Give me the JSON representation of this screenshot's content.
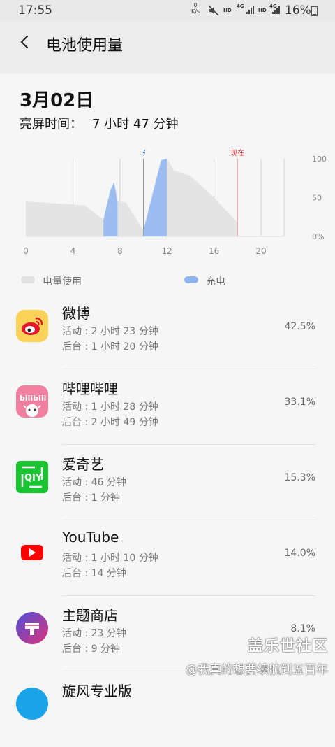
{
  "status": {
    "time": "17:55",
    "net_speed_value": "0",
    "net_speed_unit": "K/s",
    "hd1": "HD",
    "lte1": "4G",
    "hd2": "HD",
    "lte2": "4G",
    "battery_pct": "16%"
  },
  "header": {
    "title": "电池使用量"
  },
  "summary": {
    "date": "3月02日",
    "screen_on_label": "亮屏时间：",
    "screen_on_value": "7 小时 47 分钟"
  },
  "chart_data": {
    "type": "area",
    "x_ticks": [
      "0",
      "4",
      "8",
      "12",
      "16",
      "20"
    ],
    "y_ticks": [
      "100",
      "50",
      "0%"
    ],
    "xlim": [
      0,
      20
    ],
    "ylim": [
      0,
      100
    ],
    "now_label": "现在",
    "now_x": 18,
    "charge_marker_x": 10,
    "series": [
      {
        "name": "电量使用",
        "color": "#e4e4e4",
        "points": [
          [
            0,
            46
          ],
          [
            4.2,
            43
          ],
          [
            5.2,
            41
          ],
          [
            5.5,
            39
          ],
          [
            6.6,
            35
          ],
          [
            7.8,
            28
          ],
          [
            8.0,
            41
          ],
          [
            9.2,
            62
          ],
          [
            10.1,
            67
          ],
          [
            10.5,
            63
          ],
          [
            11.2,
            70
          ],
          [
            12.2,
            72
          ],
          [
            13.7,
            70
          ],
          [
            16.2,
            48
          ],
          [
            18.0,
            21
          ]
        ]
      },
      {
        "name": "充电",
        "color": "#9dbdf0",
        "ranges": [
          [
            6.6,
            7.8
          ],
          [
            10.0,
            12.0
          ]
        ]
      }
    ],
    "battery_points": [
      [
        0,
        45
      ],
      [
        5.0,
        40
      ],
      [
        6.6,
        22
      ],
      [
        7.2,
        60
      ],
      [
        7.5,
        70
      ],
      [
        7.8,
        45
      ],
      [
        8.5,
        44
      ],
      [
        10.0,
        8
      ],
      [
        11.5,
        98
      ],
      [
        12.0,
        100
      ],
      [
        12.6,
        85
      ],
      [
        14.0,
        78
      ],
      [
        16.0,
        50
      ],
      [
        18.0,
        18
      ]
    ]
  },
  "legend": [
    {
      "label": "电量使用",
      "color": "#e2e2e2"
    },
    {
      "label": "充电",
      "color": "#8db4ef"
    }
  ],
  "apps": [
    {
      "name": "微博",
      "active": "活动 : 2 小时 23 分钟",
      "background": "后台 : 1 小时 20 分钟",
      "percent": "42.5%",
      "icon": "weibo-icon"
    },
    {
      "name": "哔哩哔哩",
      "active": "活动 : 1 小时 28 分钟",
      "background": "后台 : 2 小时 49 分钟",
      "percent": "33.1%",
      "icon": "bilibili-icon"
    },
    {
      "name": "爱奇艺",
      "active": "活动 : 46 分钟",
      "background": "后台 : 1 分钟",
      "percent": "15.3%",
      "icon": "iqiyi-icon"
    },
    {
      "name": "YouTube",
      "active": "活动 : 1 小时 10 分钟",
      "background": "后台 : 14 分钟",
      "percent": "14.0%",
      "icon": "youtube-icon"
    },
    {
      "name": "主题商店",
      "active": "活动 : 23 分钟",
      "background": "后台 : 9 分钟",
      "percent": "8.1%",
      "icon": "theme-store-icon"
    },
    {
      "name": "旋风专业版",
      "active": "",
      "background": "",
      "percent": "",
      "icon": "xuanfeng-icon"
    }
  ],
  "watermark": {
    "brand": "盖乐世社区",
    "user": "@我真的想要续航到五百年"
  }
}
